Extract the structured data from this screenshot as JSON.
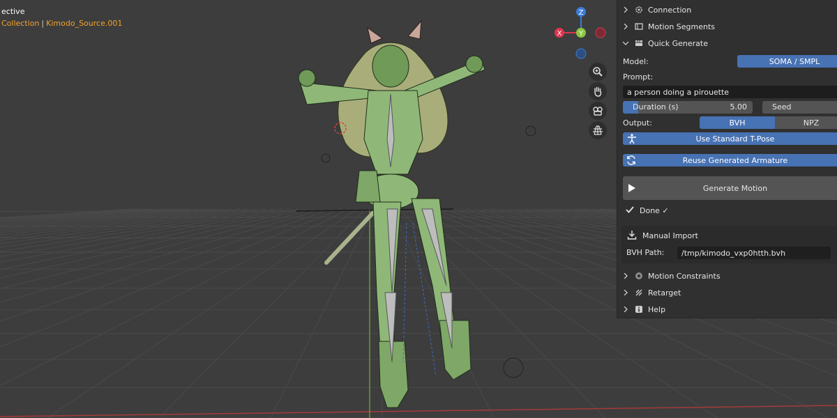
{
  "viewport": {
    "mode_label": "ective",
    "collection": "Collection",
    "separator": "|",
    "object": "Kimodo_Source.001",
    "gizmo": {
      "z": "Z",
      "y": "Y",
      "x": "X"
    }
  },
  "nav_icons": [
    "zoom-icon",
    "hand-pan-icon",
    "camera-icon",
    "grid-icon"
  ],
  "sidebar": {
    "panels_top": [
      {
        "title": "Connection",
        "icon": "connection-gear-icon"
      },
      {
        "title": "Motion Segments",
        "icon": "motion-segments-icon"
      }
    ],
    "quick_generate": {
      "title": "Quick Generate",
      "model_label": "Model:",
      "model_value": "SOMA / SMPL",
      "prompt_label": "Prompt:",
      "prompt_value": "a person doing a pirouette",
      "duration_label": "Duration (s)",
      "duration_value": "5.00",
      "duration_fraction": 0.12,
      "seed_label": "Seed",
      "seed_value": "-",
      "output_label": "Output:",
      "output_bvh": "BVH",
      "output_npz": "NPZ",
      "tpose_label": "Use Standard T-Pose",
      "reuse_label": "Reuse Generated Armature",
      "generate_label": "Generate Motion",
      "status": "Done ✓",
      "manual_import": {
        "title": "Manual Import",
        "path_label": "BVH Path:",
        "path_value": "/tmp/kimodo_vxp0htth.bvh"
      }
    },
    "panels_bottom": [
      {
        "title": "Motion Constraints",
        "icon": "constraints-icon"
      },
      {
        "title": "Retarget",
        "icon": "retarget-icon"
      },
      {
        "title": "Help",
        "icon": "info-icon"
      }
    ]
  },
  "colors": {
    "accent": "#4772b3",
    "collection_text": "#f2a32b",
    "mesh_green": "#8fb878",
    "axis_x": "#e0344f",
    "axis_y": "#8cc63f",
    "axis_z": "#3d7bd6"
  }
}
